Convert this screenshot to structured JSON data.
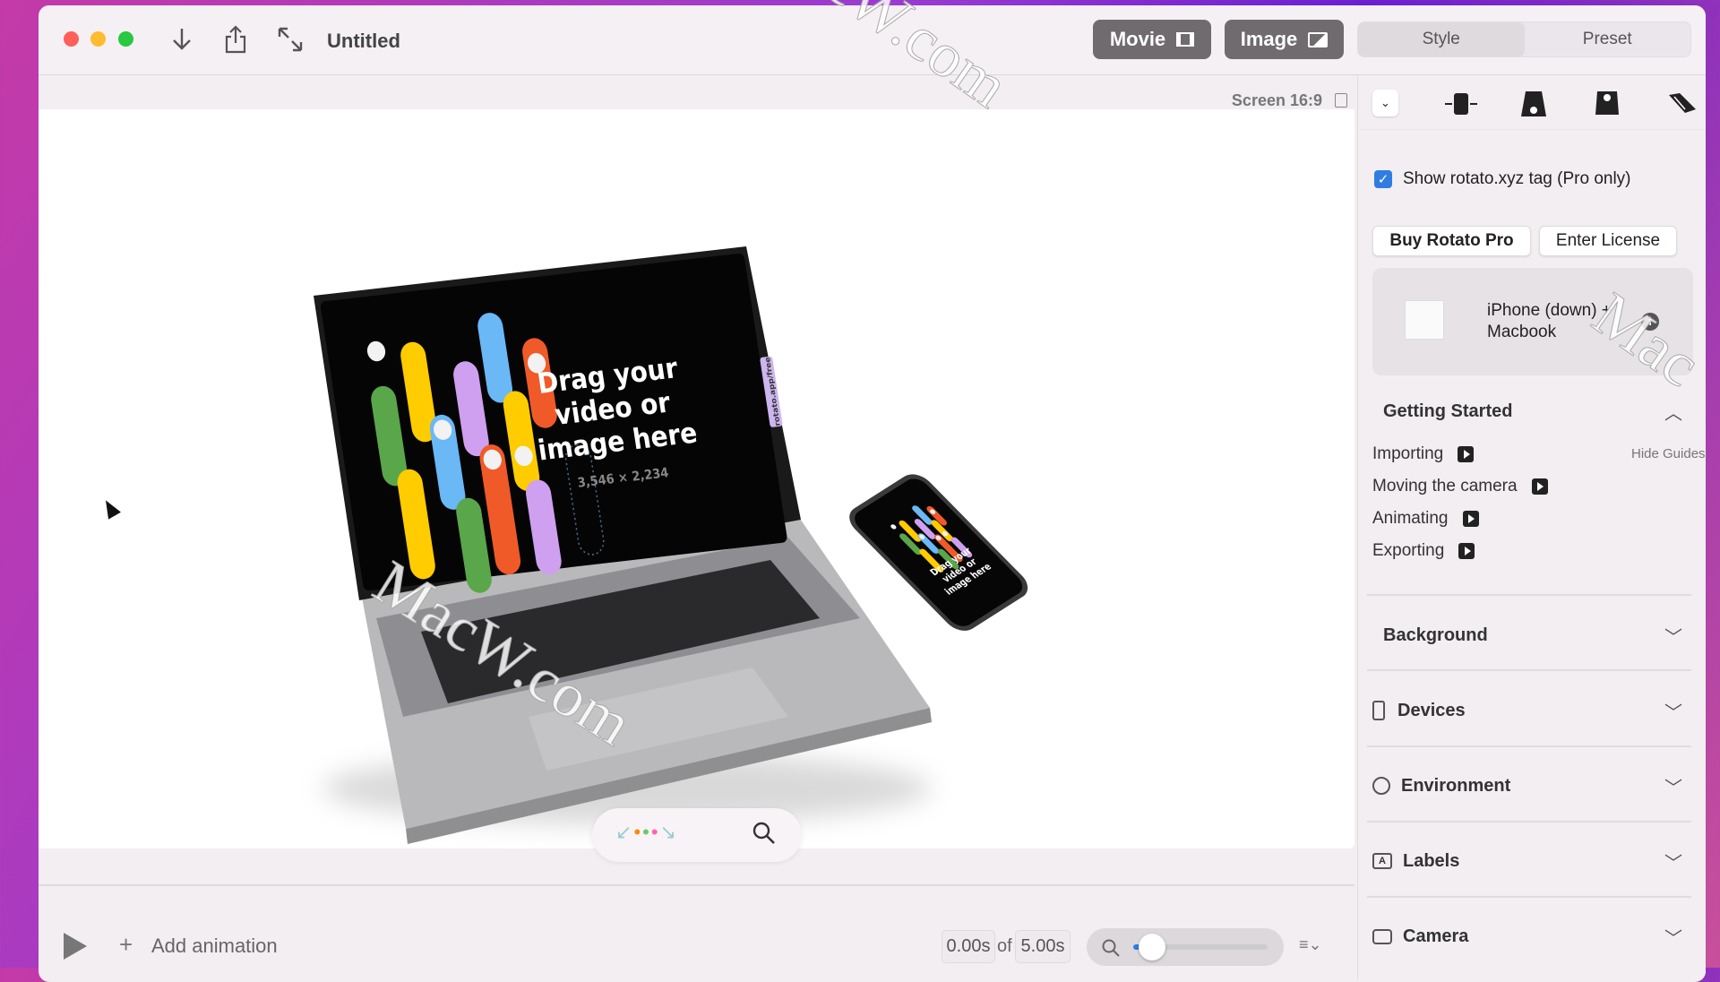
{
  "window": {
    "title": "Untitled"
  },
  "toolbar": {
    "movie_label": "Movie",
    "image_label": "Image",
    "tabs": [
      {
        "label": "Style",
        "active": true
      },
      {
        "label": "Preset",
        "active": false
      }
    ],
    "icons": [
      "download-icon",
      "share-icon",
      "expand-icon"
    ]
  },
  "canvas": {
    "screen_label": "Screen 16:9",
    "laptop_screen": {
      "headline": [
        "Drag your",
        "video or",
        "image here"
      ],
      "dimensions": "3,546 × 2,234",
      "tag": "rotato.app/free",
      "pill_colors": [
        "#5aa64a",
        "#ffcc00",
        "#ffcc00",
        "#6ab8f5",
        "#5aa64a",
        "#cf9ff0",
        "#6ab8f5",
        "#f05a28",
        "#ffcc00",
        "#cf9ff0",
        "#f05a28"
      ]
    },
    "phone_screen": {
      "headline": [
        "Drag your",
        "video or",
        "image here"
      ]
    }
  },
  "timeline": {
    "add_animation": "Add animation",
    "current_time": "0.00s",
    "of": "of",
    "duration": "5.00s",
    "zoom_level": 0.05
  },
  "sidebar": {
    "show_tag_label": "Show rotato.xyz tag (Pro only)",
    "show_tag_checked": true,
    "buy_label": "Buy Rotato Pro",
    "license_label": "Enter License",
    "preset_name": "iPhone (down) + Macbook",
    "getting_started": {
      "title": "Getting Started",
      "hide_guides": "Hide Guides",
      "items": [
        "Importing",
        "Moving the camera",
        "Animating",
        "Exporting"
      ]
    },
    "sections": [
      {
        "label": "Background",
        "icon": ""
      },
      {
        "label": "Devices",
        "icon": "phone-icon"
      },
      {
        "label": "Environment",
        "icon": "globe-icon"
      },
      {
        "label": "Labels",
        "icon": "label-icon"
      },
      {
        "label": "Camera",
        "icon": "camera-icon"
      }
    ]
  },
  "watermark": "MacW.com"
}
